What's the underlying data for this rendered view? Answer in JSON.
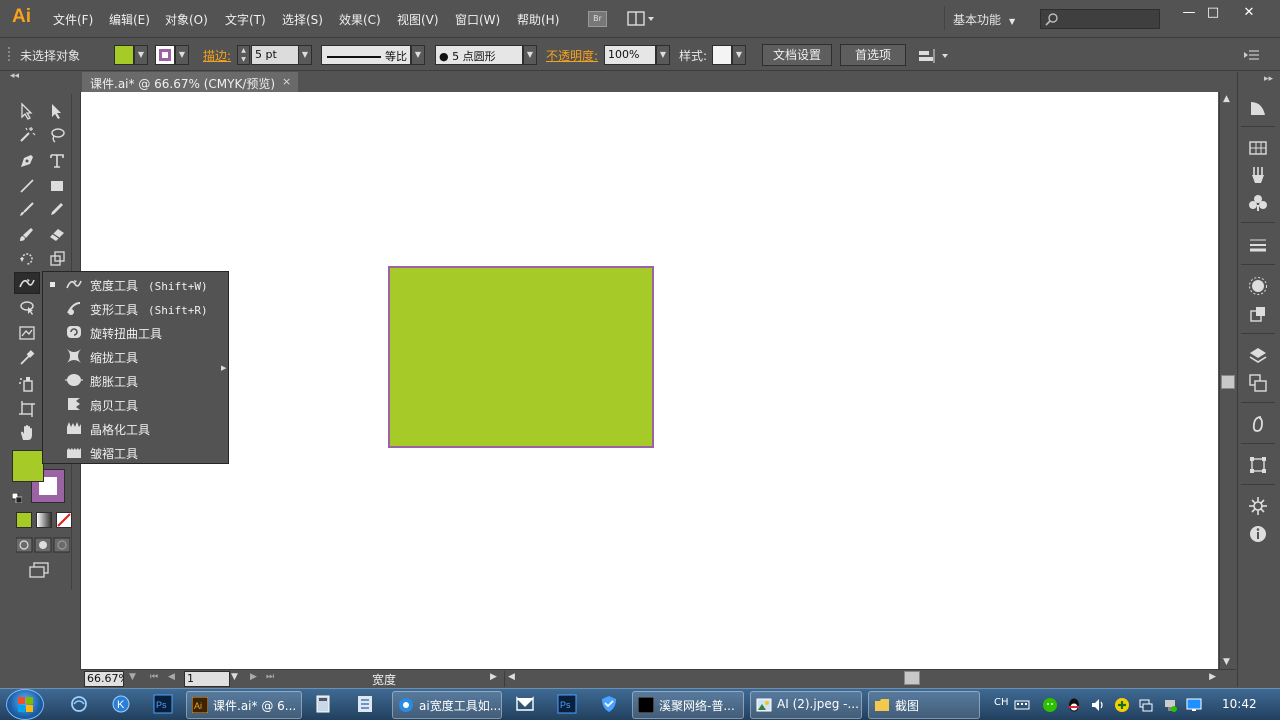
{
  "app": {
    "logo": "Ai",
    "menu": [
      "文件(F)",
      "编辑(E)",
      "对象(O)",
      "文字(T)",
      "选择(S)",
      "效果(C)",
      "视图(V)",
      "窗口(W)",
      "帮助(H)"
    ],
    "bridge_label": "Br",
    "workspace_label": "基本功能",
    "search_placeholder": "",
    "window_buttons": {
      "minimize": "—",
      "maximize": "□",
      "close": "✕"
    }
  },
  "control_bar": {
    "selection_status": "未选择对象",
    "fill_color": "#a6cb28",
    "stroke_color": "#9b63a4",
    "stroke_label": "描边:",
    "stroke_weight": "5 pt",
    "stroke_profile": "等比",
    "brush": "5 点圆形",
    "opacity_label": "不透明度:",
    "opacity_value": "100%",
    "style_label": "样式:",
    "doc_setup_button": "文档设置",
    "preferences_button": "首选项"
  },
  "document": {
    "tab_title": "课件.ai* @ 66.67% (CMYK/预览)",
    "tab_close": "×",
    "rectangle_fill": "#a6cb28",
    "rectangle_stroke": "#9b63a4"
  },
  "flyout": {
    "items": [
      {
        "label": "宽度工具",
        "shortcut": "(Shift+W)",
        "icon": "width-tool-icon",
        "selected": true
      },
      {
        "label": "变形工具",
        "shortcut": "(Shift+R)",
        "icon": "warp-tool-icon",
        "selected": false
      },
      {
        "label": "旋转扭曲工具",
        "shortcut": "",
        "icon": "twirl-tool-icon",
        "selected": false
      },
      {
        "label": "缩拢工具",
        "shortcut": "",
        "icon": "pucker-tool-icon",
        "selected": false
      },
      {
        "label": "膨胀工具",
        "shortcut": "",
        "icon": "bloat-tool-icon",
        "selected": false
      },
      {
        "label": "扇贝工具",
        "shortcut": "",
        "icon": "scallop-tool-icon",
        "selected": false
      },
      {
        "label": "晶格化工具",
        "shortcut": "",
        "icon": "crystallize-tool-icon",
        "selected": false
      },
      {
        "label": "皱褶工具",
        "shortcut": "",
        "icon": "wrinkle-tool-icon",
        "selected": false
      }
    ]
  },
  "status_bar": {
    "zoom": "66.67%",
    "artboard": "1",
    "tool_name": "宽度"
  },
  "taskbar": {
    "tasks": [
      {
        "label": "课件.ai* @ 6...",
        "icon": "illustrator-icon"
      },
      {
        "label": "ai宽度工具如...",
        "icon": "browser-icon"
      },
      {
        "label": "溪聚网络-普...",
        "icon": "terminal-icon"
      },
      {
        "label": "AI (2).jpeg -...",
        "icon": "image-viewer-icon"
      },
      {
        "label": "截图",
        "icon": "folder-icon"
      }
    ],
    "ime": "CH",
    "clock": "10:42"
  }
}
